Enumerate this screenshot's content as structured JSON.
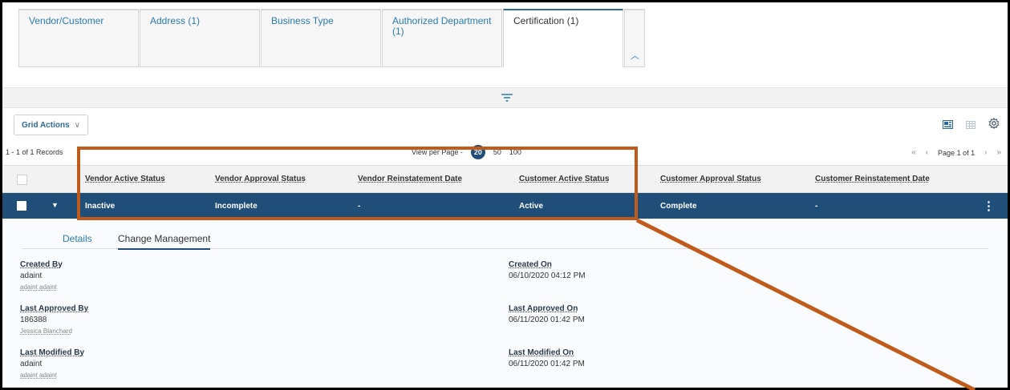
{
  "tabs": [
    {
      "label": "Vendor/Customer",
      "active": false
    },
    {
      "label": "Address (1)",
      "active": false
    },
    {
      "label": "Business Type",
      "active": false
    },
    {
      "label": "Authorized Department (1)",
      "active": false
    },
    {
      "label": "Certification (1)",
      "active": true
    }
  ],
  "toolbar": {
    "grid_actions_label": "Grid Actions",
    "chevron": "∨"
  },
  "records": {
    "count_text": "1 - 1 of 1 Records",
    "view_per_page_label": "View per Page -",
    "per_page_options": [
      "20",
      "50",
      "100"
    ],
    "selected_per_page": "20",
    "page_text": "Page 1 of 1"
  },
  "grid": {
    "columns": [
      "Vendor Active Status",
      "Vendor Approval Status",
      "Vendor Reinstatement Date",
      "Customer Active Status",
      "Customer Approval Status",
      "Customer Reinstatement Date"
    ],
    "row": [
      "Inactive",
      "Incomplete",
      "-",
      "Active",
      "Complete",
      "-"
    ]
  },
  "detail": {
    "tabs": [
      "Details",
      "Change Management"
    ],
    "active_tab": "Change Management",
    "fields_left": [
      {
        "label": "Created By",
        "value": "adaint",
        "sub": "adaint adaint"
      },
      {
        "label": "Last Approved By",
        "value": "186388",
        "sub": "Jessica Blanchard"
      },
      {
        "label": "Last Modified By",
        "value": "adaint",
        "sub": "adaint adaint"
      }
    ],
    "fields_right": [
      {
        "label": "Created On",
        "value": "06/10/2020 04:12 PM"
      },
      {
        "label": "Last Approved On",
        "value": "06/11/2020 01:42 PM"
      },
      {
        "label": "Last Modified On",
        "value": "06/11/2020 01:42 PM"
      }
    ]
  },
  "colors": {
    "accent": "#1f4e79",
    "link": "#2b7bb0",
    "annotation": "#c15b1b"
  },
  "icons": {
    "filter": "filter-icon",
    "collapse": "chevron-up-icon",
    "settings": "gear-icon",
    "grid_view": "grid-view-icon",
    "card_view": "card-view-icon",
    "row_menu": "kebab-menu-icon",
    "expand": "caret-down-icon"
  }
}
